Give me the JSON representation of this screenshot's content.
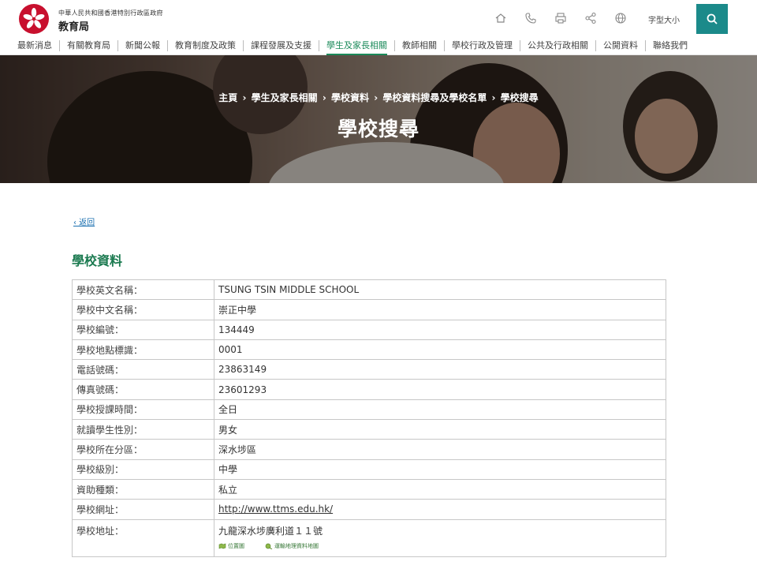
{
  "header": {
    "org_small": "中華人民共和國香港特別行政區政府",
    "org_big": "教育局",
    "font_size_label": "字型大小",
    "tool_icons": [
      "home-icon",
      "phone-icon",
      "print-icon",
      "share-icon",
      "globe-icon"
    ],
    "search_icon": "search-icon",
    "accent_color": "#1b8a8a"
  },
  "nav": {
    "items": [
      "最新消息",
      "有關教育局",
      "新聞公報",
      "教育制度及政策",
      "課程發展及支援",
      "學生及家長相關",
      "教師相關",
      "學校行政及管理",
      "公共及行政相關",
      "公開資料",
      "聯絡我們"
    ],
    "active_index": 5,
    "active_color": "#1b8a5a"
  },
  "banner": {
    "breadcrumb": [
      "主頁",
      "學生及家長相關",
      "學校資料",
      "學校資料搜尋及學校名單",
      "學校搜尋"
    ],
    "separator": "›",
    "title": "學校搜尋"
  },
  "content": {
    "back_label": "‹ 返回",
    "section_title": "學校資料",
    "rows": [
      {
        "label": "學校英文名稱：",
        "value": "TSUNG TSIN MIDDLE SCHOOL"
      },
      {
        "label": "學校中文名稱：",
        "value": "崇正中學"
      },
      {
        "label": "學校編號：",
        "value": "134449"
      },
      {
        "label": "學校地點標識：",
        "value": "0001"
      },
      {
        "label": "電話號碼：",
        "value": "23863149"
      },
      {
        "label": "傳真號碼：",
        "value": "23601293"
      },
      {
        "label": "學校授課時間：",
        "value": "全日"
      },
      {
        "label": "就讀學生性別：",
        "value": "男女"
      },
      {
        "label": "學校所在分區：",
        "value": "深水埗區"
      },
      {
        "label": "學校級別：",
        "value": "中學"
      },
      {
        "label": "資助種類：",
        "value": "私立"
      },
      {
        "label": "學校網址：",
        "value": "http://www.ttms.edu.hk/"
      },
      {
        "label": "學校地址：",
        "value": "九龍深水埗廣利道１１號"
      }
    ],
    "map_links": [
      "位置圖",
      "運輸地理資料地圖"
    ]
  }
}
